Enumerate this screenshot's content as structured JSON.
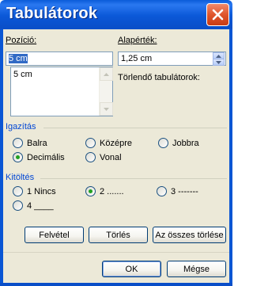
{
  "window": {
    "title": "Tabulátorok"
  },
  "position": {
    "label": "Pozíció:",
    "value": "5 cm",
    "list_items": [
      "5 cm"
    ]
  },
  "default_stops": {
    "label": "Alapérték:",
    "value": "1,25 cm"
  },
  "to_clear": {
    "label": "Törlendő tabulátorok:"
  },
  "alignment": {
    "title": "Igazítás",
    "options": [
      "Balra",
      "Középre",
      "Jobbra",
      "Decimális",
      "Vonal"
    ],
    "selected": "Decimális"
  },
  "leader": {
    "title": "Kitöltés",
    "options": [
      "1 Nincs",
      "2 .......",
      "3 -------",
      "4 ____"
    ],
    "selected": "2 ......."
  },
  "buttons": {
    "set": "Felvétel",
    "clear": "Törlés",
    "clear_all": "Az összes törlése",
    "ok": "OK",
    "cancel": "Mégse"
  },
  "colors": {
    "titlebar": "#0a56d4",
    "dialog_bg": "#ece9d8",
    "group_title": "#0046d5",
    "selection": "#316ac5",
    "close_button": "#e0552c"
  }
}
